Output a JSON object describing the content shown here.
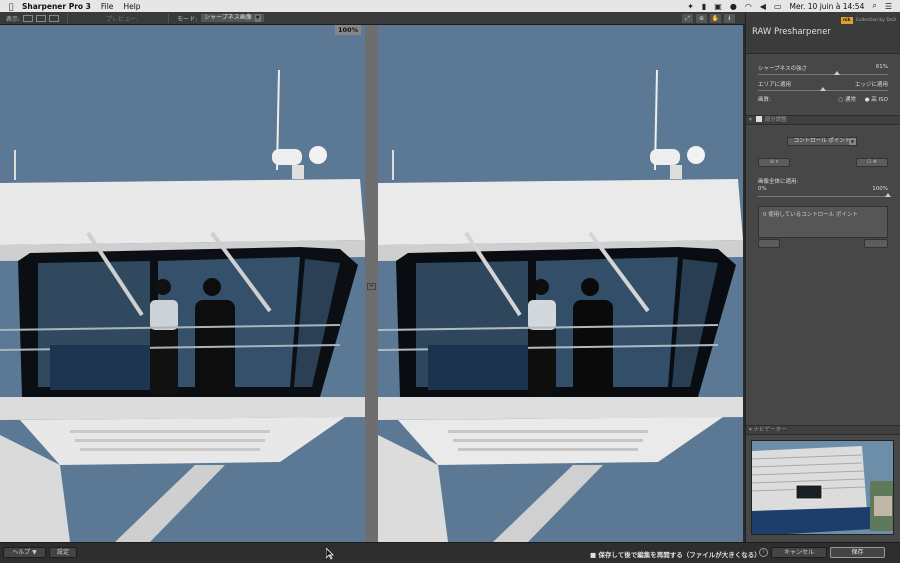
{
  "menubar": {
    "apple_icon": "apple-icon",
    "app_name": "Sharpener Pro 3",
    "items": [
      "File",
      "Help"
    ],
    "clock": "Mer. 10 juin à 14:54"
  },
  "toolbar": {
    "view_label": "表示:",
    "preview_label": "プレビュー:",
    "mode_label": "モード:",
    "mode_value": "シャープネス画像"
  },
  "preview": {
    "zoom": "100%"
  },
  "sidebar": {
    "title": "RAW Presharpener",
    "brand_logo": "nik",
    "brand_text": "Collection by DxO",
    "sharpness": {
      "label": "シャープネスの強さ",
      "value_text": "61%",
      "value": 0.61
    },
    "area_label": "エリアに適用",
    "edge_label": "エッジに適用",
    "area_edge_value": 0.5,
    "quality": {
      "label": "画質:",
      "options": [
        "通常",
        "高 ISO"
      ],
      "selected": "高 ISO"
    },
    "partial_section": "部分調整",
    "control_point_dropdown": "コントロール ポイント",
    "apply_whole_label": "画像全体に適用:",
    "range_min": "0%",
    "range_max": "100%",
    "cp_list_text": "0 使用しているコントロール ポイント",
    "navigator_label": "ナビゲーター"
  },
  "bottombar": {
    "help_button": "ヘルプ ▼",
    "settings_button": "設定",
    "save_note": "保存して後で編集を再開する（ファイルが大きくなる）",
    "cancel_button": "キャンセル",
    "save_button": "保存"
  },
  "colors": {
    "sky": "#5a7894",
    "panel": "#474747",
    "brand": "#e0a030"
  }
}
